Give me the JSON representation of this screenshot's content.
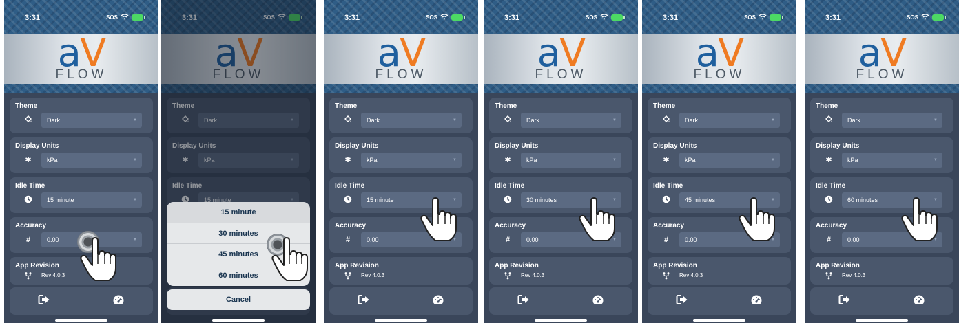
{
  "status": {
    "time": "3:31",
    "sos": "SOS"
  },
  "logo": {
    "a": "a",
    "v": "V",
    "flow": "FLOW"
  },
  "labels": {
    "theme": "Theme",
    "display_units": "Display Units",
    "idle_time": "Idle Time",
    "accuracy": "Accuracy",
    "app_revision": "App Revision"
  },
  "values": {
    "theme": "Dark",
    "display_units": "kPa",
    "accuracy": "0.00",
    "revision": "Rev 4.0.3"
  },
  "screens": [
    {
      "idle_time": "15 minute"
    },
    {
      "idle_time": "15 minute"
    },
    {
      "idle_time": "15 minute"
    },
    {
      "idle_time": "30 minutes"
    },
    {
      "idle_time": "45 minutes"
    },
    {
      "idle_time": "60 minutes"
    }
  ],
  "picker": {
    "options": [
      "15 minute",
      "30 minutes",
      "45 minutes",
      "60 minutes"
    ],
    "cancel": "Cancel"
  },
  "icons": {
    "theme": "paint-bucket-icon",
    "units": "gear-icon",
    "idle": "clock-icon",
    "accuracy": "hash-icon",
    "revision": "branch-icon",
    "logout": "logout-icon",
    "dashboard": "gauge-icon"
  },
  "colors": {
    "background": "#3a465a",
    "card": "#4a576c",
    "select": "#5b6a82",
    "logo_blue": "#1f5f9e",
    "logo_orange": "#ef7b22"
  }
}
